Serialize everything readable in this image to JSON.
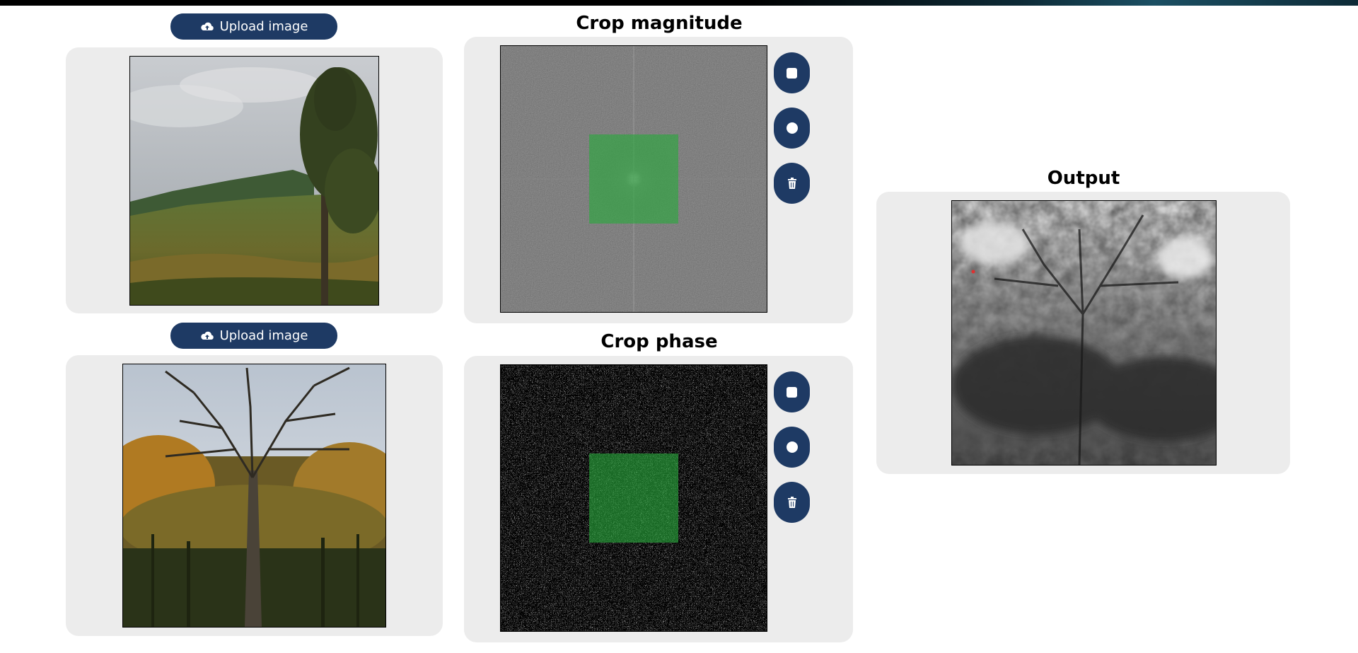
{
  "inputs": [
    {
      "upload_label": "Upload image",
      "image_description": "landscape-with-tree"
    },
    {
      "upload_label": "Upload image",
      "image_description": "bare-tree-forest"
    }
  ],
  "crop_panels": [
    {
      "title": "Crop magnitude",
      "tools": [
        "square-select-icon",
        "circle-select-icon",
        "trash-icon"
      ]
    },
    {
      "title": "Crop phase",
      "tools": [
        "square-select-icon",
        "circle-select-icon",
        "trash-icon"
      ]
    }
  ],
  "output": {
    "title": "Output"
  },
  "colors": {
    "button_bg": "#1e3a64",
    "panel_bg": "#ececec",
    "crop_overlay": "#28aa3c"
  }
}
